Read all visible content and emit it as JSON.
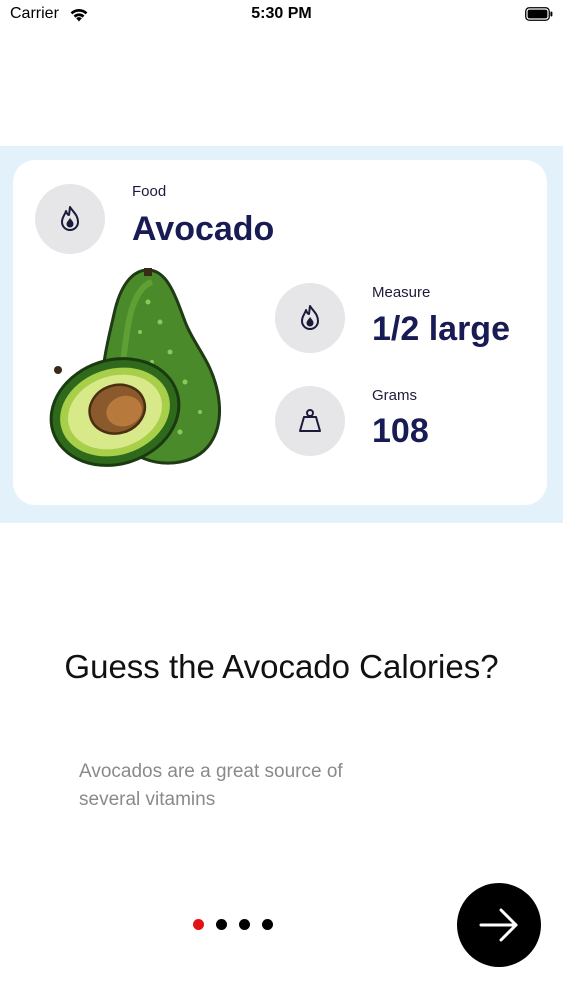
{
  "status_bar": {
    "carrier": "Carrier",
    "time": "5:30 PM"
  },
  "card": {
    "food_label": "Food",
    "food_value": "Avocado",
    "measure_label": "Measure",
    "measure_value": "1/2 large",
    "grams_label": "Grams",
    "grams_value": "108",
    "icons": {
      "food": "flame-icon",
      "measure": "flame-icon",
      "grams": "weight-icon"
    },
    "colors": {
      "band": "#e3f1fa",
      "value_text": "#181b54",
      "icon_circle": "#e6e6e9"
    }
  },
  "main": {
    "question": "Guess the Avocado Calories?",
    "description": "Avocados are a great source of several vitamins"
  },
  "pager": {
    "total": 4,
    "active_index": 0,
    "active_color": "#e31212"
  },
  "next_button": {
    "icon": "arrow-right-icon"
  }
}
